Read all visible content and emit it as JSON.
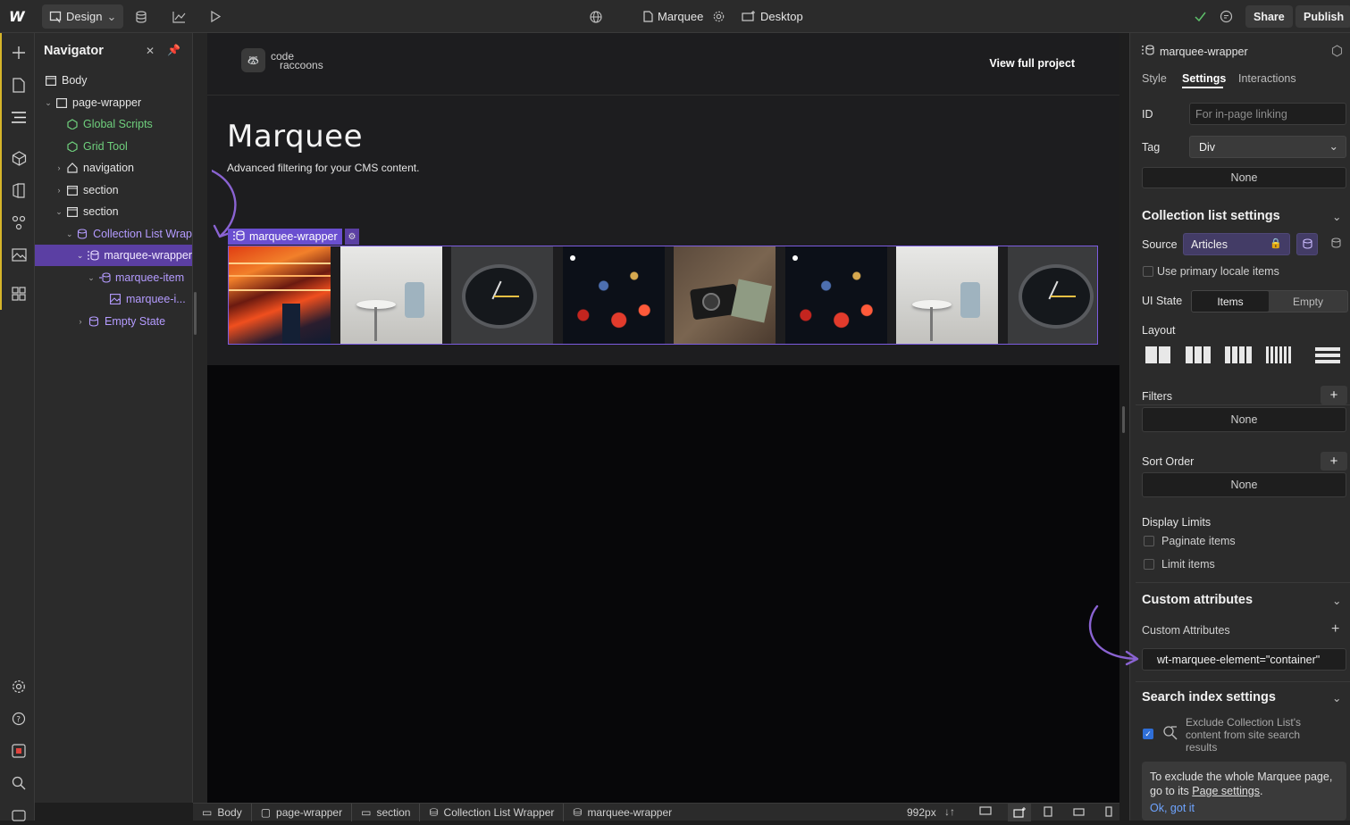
{
  "topbar": {
    "mode_label": "Design",
    "page_name": "Marquee",
    "breakpoint": "Desktop",
    "share_label": "Share",
    "publish_label": "Publish"
  },
  "navigator": {
    "title": "Navigator",
    "items": [
      {
        "label": "Body"
      },
      {
        "label": "page-wrapper"
      },
      {
        "label": "Global Scripts"
      },
      {
        "label": "Grid Tool"
      },
      {
        "label": "navigation"
      },
      {
        "label": "section"
      },
      {
        "label": "section"
      },
      {
        "label": "Collection List Wrap"
      },
      {
        "label": "marquee-wrapper"
      },
      {
        "label": "marquee-item"
      },
      {
        "label": "marquee-i..."
      },
      {
        "label": "Empty State"
      }
    ]
  },
  "canvas": {
    "logo_text_1": "code",
    "logo_text_2": "raccoons",
    "view_full_label": "View full project",
    "page_title": "Marquee",
    "page_subtitle": "Advanced filtering for your CMS content.",
    "selected_label": "marquee-wrapper"
  },
  "breadcrumbs": [
    "Body",
    "page-wrapper",
    "section",
    "Collection List Wrapper",
    "marquee-wrapper"
  ],
  "bottom": {
    "width_readout": "992px"
  },
  "right_panel": {
    "element_name": "marquee-wrapper",
    "tabs": [
      "Style",
      "Settings",
      "Interactions"
    ],
    "id_label": "ID",
    "id_placeholder": "For in-page linking",
    "tag_label": "Tag",
    "tag_value": "Div",
    "none_top": "None",
    "collection_title": "Collection list settings",
    "source_label": "Source",
    "source_value": "Articles",
    "primary_locale_label": "Use primary locale items",
    "ui_state_label": "UI State",
    "ui_state_items": "Items",
    "ui_state_empty": "Empty",
    "layout_label": "Layout",
    "filters_label": "Filters",
    "filters_value": "None",
    "sort_label": "Sort Order",
    "sort_value": "None",
    "display_limits_label": "Display Limits",
    "paginate_label": "Paginate items",
    "limit_label": "Limit items",
    "custom_attr_title": "Custom attributes",
    "custom_attr_label": "Custom Attributes",
    "custom_attr_value": "wt-marquee-element=\"container\"",
    "search_title": "Search index settings",
    "exclude_label": "Exclude Collection List's content from site search results",
    "note_text": "To exclude the whole Marquee page, go to its",
    "note_link": "Page settings",
    "note_end": ".",
    "ok_label": "Ok, got it"
  },
  "colors": {
    "accent": "#7c5ce0",
    "green": "#6fd07d",
    "selected_row": "#5b3fa3"
  }
}
